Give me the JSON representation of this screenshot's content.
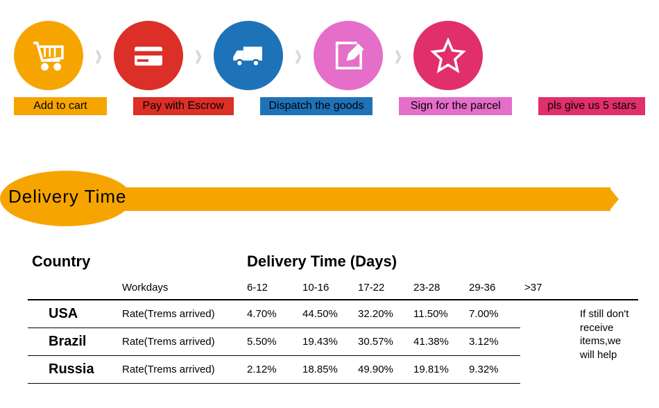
{
  "steps": [
    {
      "label": "Add to cart",
      "bg": "#f6a500",
      "label_bg": "#f6a500",
      "label_w": 148
    },
    {
      "label": "Pay with Escrow",
      "bg": "#db2f27",
      "label_bg": "#db2f27",
      "label_w": 160
    },
    {
      "label": "Dispatch the goods",
      "bg": "#1e73b8",
      "label_bg": "#1e73b8",
      "label_w": 180
    },
    {
      "label": "Sign for the parcel",
      "bg": "#e56ec9",
      "label_bg": "#e56ec9",
      "label_w": 180
    },
    {
      "label": "pls give us 5 stars",
      "bg": "#e02f6b",
      "label_bg": "#e02f6b",
      "label_w": 170
    }
  ],
  "banner": {
    "title": "Delivery Time"
  },
  "table": {
    "header_country": "Country",
    "header_delivery": "Delivery Time (Days)",
    "workdays_label": "Workdays",
    "rate_label": "Rate(Trems arrived)",
    "day_ranges": [
      "6-12",
      "10-16",
      "17-22",
      "23-28",
      "29-36",
      ">37"
    ],
    "rows": [
      {
        "country": "USA",
        "pcts": [
          "4.70%",
          "44.50%",
          "32.20%",
          "11.50%",
          "7.00%"
        ]
      },
      {
        "country": "Brazil",
        "pcts": [
          "5.50%",
          "19.43%",
          "30.57%",
          "41.38%",
          "3.12%"
        ]
      },
      {
        "country": "Russia",
        "pcts": [
          "2.12%",
          "18.85%",
          "49.90%",
          "19.81%",
          "9.32%"
        ]
      }
    ],
    "side_note": "If still don't receive items,we will help"
  }
}
